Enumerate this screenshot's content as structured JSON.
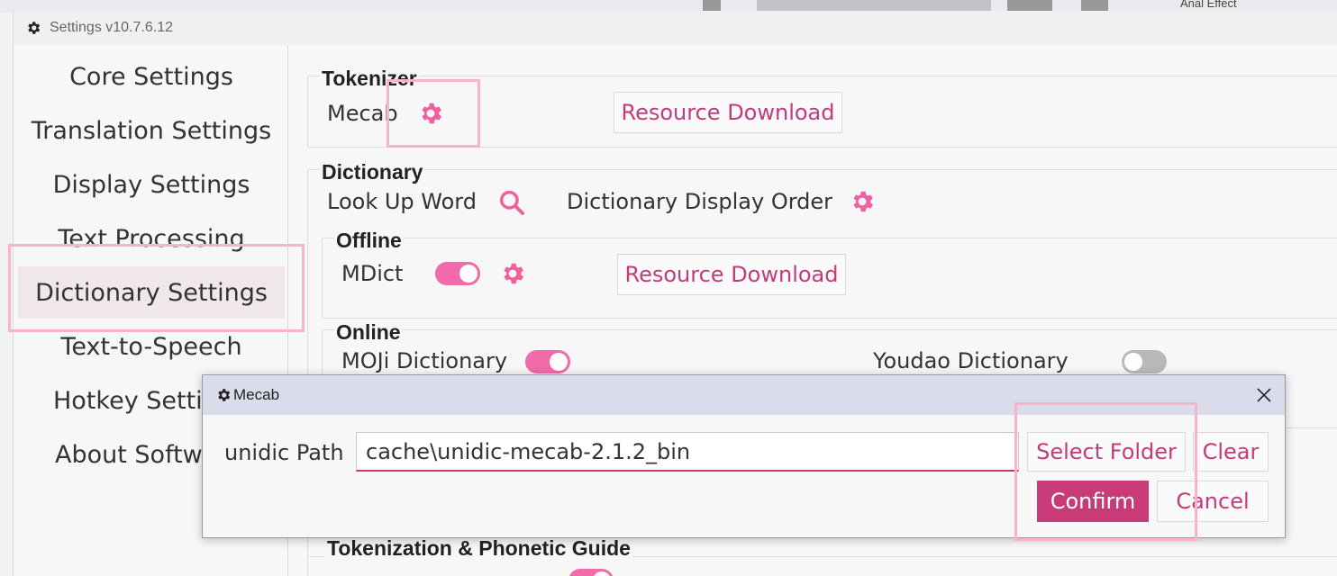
{
  "window": {
    "title": "Settings v10.7.6.12"
  },
  "background_text": "Anal Effect",
  "sidebar": {
    "items": [
      {
        "label": "Core Settings"
      },
      {
        "label": "Translation Settings"
      },
      {
        "label": "Display Settings"
      },
      {
        "label": "Text Processing"
      },
      {
        "label": "Dictionary Settings",
        "active": true
      },
      {
        "label": "Text-to-Speech"
      },
      {
        "label": "Hotkey Setti"
      },
      {
        "label": "About Softw"
      }
    ]
  },
  "tokenizer": {
    "title": "Tokenizer",
    "mecab_label": "Mecab",
    "resource_download": "Resource Download"
  },
  "dictionary": {
    "title": "Dictionary",
    "look_up_word": "Look Up Word",
    "display_order": "Dictionary Display Order",
    "offline": {
      "title": "Offline",
      "mdict_label": "MDict",
      "mdict_enabled": true,
      "resource_download": "Resource Download"
    },
    "online": {
      "title": "Online",
      "moji_label": "MOJi Dictionary",
      "moji_enabled": true,
      "youdao_label": "Youdao Dictionary",
      "youdao_enabled": false
    }
  },
  "tokenization": {
    "title": "Tokenization & Phonetic Guide"
  },
  "dialog": {
    "title": "Mecab",
    "path_label": "unidic Path",
    "path_value": "cache\\unidic-mecab-2.1.2_bin",
    "select_folder": "Select Folder",
    "clear": "Clear",
    "confirm": "Confirm",
    "cancel": "Cancel"
  },
  "colors": {
    "accent": "#c93b78",
    "toggle_on": "#f26aa9",
    "icon_pink": "#f0609f",
    "highlight_box": "#f5b3cd"
  }
}
